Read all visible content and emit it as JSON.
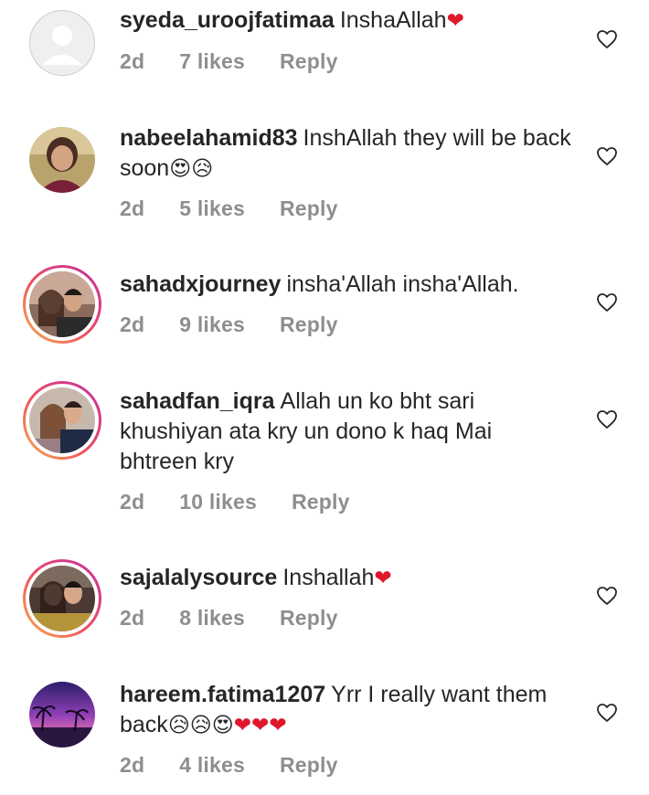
{
  "comments": [
    {
      "username": "syeda_uroojfatimaa",
      "text": "InshaAllah",
      "emojis": [
        "❤"
      ],
      "age": "2d",
      "likes": "7 likes",
      "reply": "Reply",
      "avatar": "default-avatar"
    },
    {
      "username": "nabeelahamid83",
      "text": "InshAllah they will be back soon",
      "emojis": [
        "😍",
        "😥"
      ],
      "age": "2d",
      "likes": "5 likes",
      "reply": "Reply",
      "avatar": "photo-avatar"
    },
    {
      "username": "sahadxjourney",
      "text": "insha'Allah insha'Allah.",
      "emojis": [],
      "age": "2d",
      "likes": "9 likes",
      "reply": "Reply",
      "avatar": "photo-avatar-story"
    },
    {
      "username": "sahadfan_iqra",
      "text": "Allah un ko bht sari khushiyan ata  kry un dono k haq Mai bhtreen kry",
      "emojis": [],
      "age": "2d",
      "likes": "10 likes",
      "reply": "Reply",
      "avatar": "photo-avatar-story"
    },
    {
      "username": "sajalalysource",
      "text": "Inshallah",
      "emojis": [
        "❤"
      ],
      "age": "2d",
      "likes": "8 likes",
      "reply": "Reply",
      "avatar": "photo-avatar-story"
    },
    {
      "username": "hareem.fatima1207",
      "text": "Yrr I really want them back",
      "emojis": [
        "😥",
        "😥",
        "😍",
        "❤",
        "❤",
        "❤"
      ],
      "age": "2d",
      "likes": "4 likes",
      "reply": "Reply",
      "avatar": "photo-avatar-sunset"
    }
  ],
  "colors": {
    "username": "#262626",
    "meta": "#8e8e8e",
    "heart_emoji": "#e0162b",
    "story_ring_start": "#f9b24a",
    "story_ring_end": "#c22fa0"
  },
  "icons": {
    "like": "heart-outline-icon"
  }
}
